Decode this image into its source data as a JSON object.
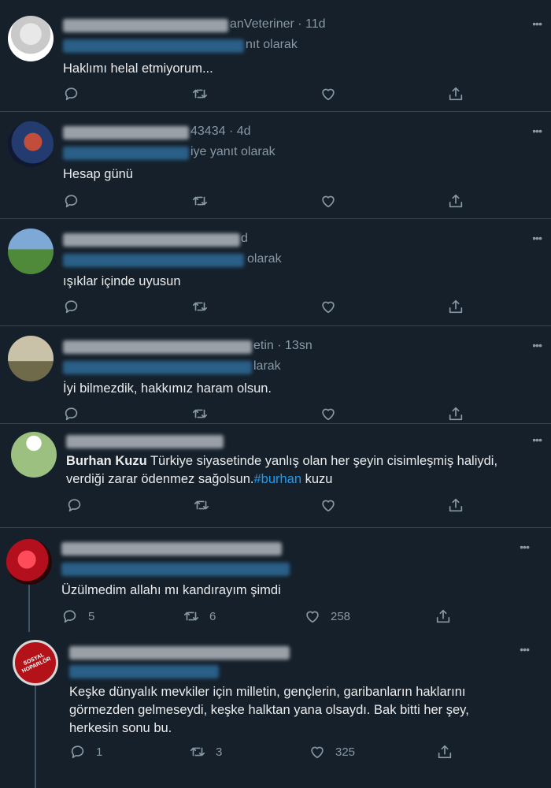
{
  "tweets": [
    {
      "meta_tail": "anVeteriner · 11d",
      "reply_tail": "nıt olarak",
      "body": "Haklımı helal etmiyorum..."
    },
    {
      "meta_tail": "43434 · 4d",
      "reply_tail": "iye yanıt olarak",
      "body": "Hesap günü"
    },
    {
      "meta_tail": "d",
      "reply_tail": "olarak",
      "body": "ışıklar içinde uyusun"
    },
    {
      "meta_tail": "etin · 13sn",
      "reply_tail": "larak",
      "body": "İyi bilmezdik, hakkımız haram olsun."
    },
    {
      "mention": "Burhan Kuzu",
      "body_line1_rest": " Türkiye siyasetinde yanlış olan her şeyin cisimleşmiş haliydi,",
      "body_line2_start": "verdiği zarar ödenmez sağolsun.",
      "hashtag": "#burhan",
      "body_line2_end": " kuzu"
    },
    {
      "body": "Üzülmedim allahı mı kandırayım şimdi",
      "replies": "5",
      "retweets": "6",
      "likes": "258"
    },
    {
      "body_line1": "Keşke dünyalık mevkiler için milletin, gençlerin, garibanların haklarını",
      "body_line2": "görmezden gelmeseydi, keşke halktan yana olsaydı. Bak bitti her şey,",
      "body_line3": "herkesin sonu bu.",
      "replies": "1",
      "retweets": "3",
      "likes": "325",
      "avatar_text": "SOSYAL HOPARLÖR"
    }
  ],
  "more_label": "•••",
  "colors": {
    "background": "#15202b",
    "secondary_text": "#8899a6",
    "link": "#1d9bf0",
    "divider": "#38444d"
  }
}
